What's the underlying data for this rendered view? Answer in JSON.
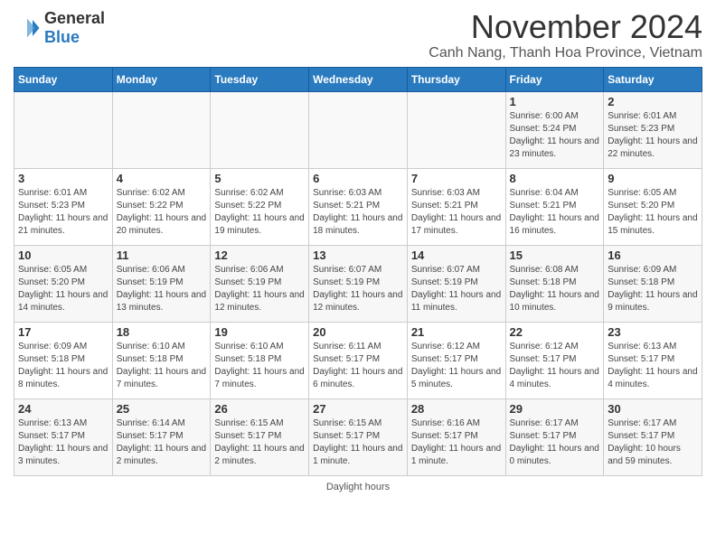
{
  "logo": {
    "general": "General",
    "blue": "Blue"
  },
  "header": {
    "month_year": "November 2024",
    "location": "Canh Nang, Thanh Hoa Province, Vietnam"
  },
  "days_of_week": [
    "Sunday",
    "Monday",
    "Tuesday",
    "Wednesday",
    "Thursday",
    "Friday",
    "Saturday"
  ],
  "footer": {
    "note": "Daylight hours"
  },
  "weeks": [
    {
      "days": [
        {
          "num": "",
          "info": ""
        },
        {
          "num": "",
          "info": ""
        },
        {
          "num": "",
          "info": ""
        },
        {
          "num": "",
          "info": ""
        },
        {
          "num": "",
          "info": ""
        },
        {
          "num": "1",
          "info": "Sunrise: 6:00 AM\nSunset: 5:24 PM\nDaylight: 11 hours\nand 23 minutes."
        },
        {
          "num": "2",
          "info": "Sunrise: 6:01 AM\nSunset: 5:23 PM\nDaylight: 11 hours\nand 22 minutes."
        }
      ]
    },
    {
      "days": [
        {
          "num": "3",
          "info": "Sunrise: 6:01 AM\nSunset: 5:23 PM\nDaylight: 11 hours\nand 21 minutes."
        },
        {
          "num": "4",
          "info": "Sunrise: 6:02 AM\nSunset: 5:22 PM\nDaylight: 11 hours\nand 20 minutes."
        },
        {
          "num": "5",
          "info": "Sunrise: 6:02 AM\nSunset: 5:22 PM\nDaylight: 11 hours\nand 19 minutes."
        },
        {
          "num": "6",
          "info": "Sunrise: 6:03 AM\nSunset: 5:21 PM\nDaylight: 11 hours\nand 18 minutes."
        },
        {
          "num": "7",
          "info": "Sunrise: 6:03 AM\nSunset: 5:21 PM\nDaylight: 11 hours\nand 17 minutes."
        },
        {
          "num": "8",
          "info": "Sunrise: 6:04 AM\nSunset: 5:21 PM\nDaylight: 11 hours\nand 16 minutes."
        },
        {
          "num": "9",
          "info": "Sunrise: 6:05 AM\nSunset: 5:20 PM\nDaylight: 11 hours\nand 15 minutes."
        }
      ]
    },
    {
      "days": [
        {
          "num": "10",
          "info": "Sunrise: 6:05 AM\nSunset: 5:20 PM\nDaylight: 11 hours\nand 14 minutes."
        },
        {
          "num": "11",
          "info": "Sunrise: 6:06 AM\nSunset: 5:19 PM\nDaylight: 11 hours\nand 13 minutes."
        },
        {
          "num": "12",
          "info": "Sunrise: 6:06 AM\nSunset: 5:19 PM\nDaylight: 11 hours\nand 12 minutes."
        },
        {
          "num": "13",
          "info": "Sunrise: 6:07 AM\nSunset: 5:19 PM\nDaylight: 11 hours\nand 12 minutes."
        },
        {
          "num": "14",
          "info": "Sunrise: 6:07 AM\nSunset: 5:19 PM\nDaylight: 11 hours\nand 11 minutes."
        },
        {
          "num": "15",
          "info": "Sunrise: 6:08 AM\nSunset: 5:18 PM\nDaylight: 11 hours\nand 10 minutes."
        },
        {
          "num": "16",
          "info": "Sunrise: 6:09 AM\nSunset: 5:18 PM\nDaylight: 11 hours\nand 9 minutes."
        }
      ]
    },
    {
      "days": [
        {
          "num": "17",
          "info": "Sunrise: 6:09 AM\nSunset: 5:18 PM\nDaylight: 11 hours\nand 8 minutes."
        },
        {
          "num": "18",
          "info": "Sunrise: 6:10 AM\nSunset: 5:18 PM\nDaylight: 11 hours\nand 7 minutes."
        },
        {
          "num": "19",
          "info": "Sunrise: 6:10 AM\nSunset: 5:18 PM\nDaylight: 11 hours\nand 7 minutes."
        },
        {
          "num": "20",
          "info": "Sunrise: 6:11 AM\nSunset: 5:17 PM\nDaylight: 11 hours\nand 6 minutes."
        },
        {
          "num": "21",
          "info": "Sunrise: 6:12 AM\nSunset: 5:17 PM\nDaylight: 11 hours\nand 5 minutes."
        },
        {
          "num": "22",
          "info": "Sunrise: 6:12 AM\nSunset: 5:17 PM\nDaylight: 11 hours\nand 4 minutes."
        },
        {
          "num": "23",
          "info": "Sunrise: 6:13 AM\nSunset: 5:17 PM\nDaylight: 11 hours\nand 4 minutes."
        }
      ]
    },
    {
      "days": [
        {
          "num": "24",
          "info": "Sunrise: 6:13 AM\nSunset: 5:17 PM\nDaylight: 11 hours\nand 3 minutes."
        },
        {
          "num": "25",
          "info": "Sunrise: 6:14 AM\nSunset: 5:17 PM\nDaylight: 11 hours\nand 2 minutes."
        },
        {
          "num": "26",
          "info": "Sunrise: 6:15 AM\nSunset: 5:17 PM\nDaylight: 11 hours\nand 2 minutes."
        },
        {
          "num": "27",
          "info": "Sunrise: 6:15 AM\nSunset: 5:17 PM\nDaylight: 11 hours\nand 1 minute."
        },
        {
          "num": "28",
          "info": "Sunrise: 6:16 AM\nSunset: 5:17 PM\nDaylight: 11 hours\nand 1 minute."
        },
        {
          "num": "29",
          "info": "Sunrise: 6:17 AM\nSunset: 5:17 PM\nDaylight: 11 hours\nand 0 minutes."
        },
        {
          "num": "30",
          "info": "Sunrise: 6:17 AM\nSunset: 5:17 PM\nDaylight: 10 hours\nand 59 minutes."
        }
      ]
    }
  ]
}
